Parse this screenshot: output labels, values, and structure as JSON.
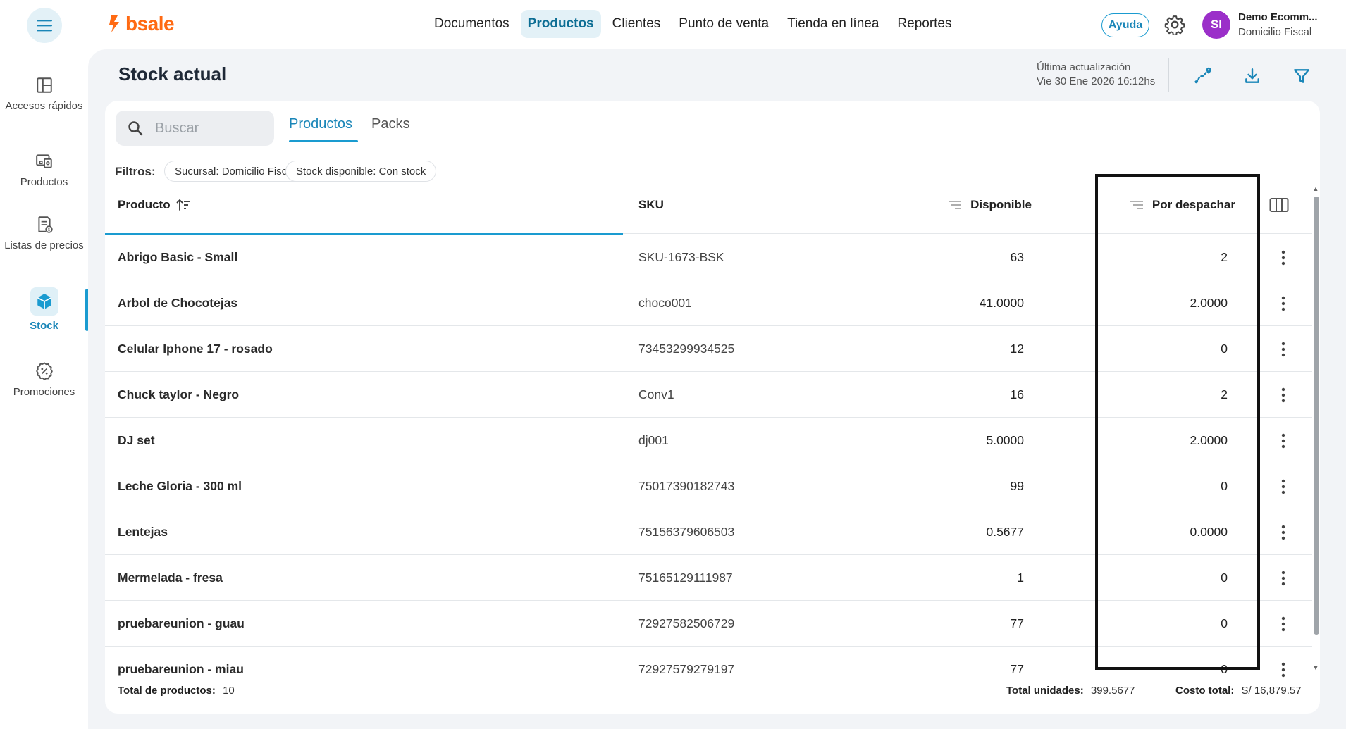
{
  "brand": {
    "logo_text": "bsale",
    "color": "#ff6a13"
  },
  "nav": {
    "items": [
      "Documentos",
      "Productos",
      "Clientes",
      "Punto de venta",
      "Tienda en línea",
      "Reportes"
    ],
    "active": "Productos"
  },
  "header": {
    "help_label": "Ayuda",
    "avatar_initials": "SI",
    "user_name": "Demo Ecomm...",
    "user_sub": "Domicilio Fiscal"
  },
  "sidebar": {
    "items": [
      {
        "label": "Accesos rápidos",
        "icon": "layout-icon"
      },
      {
        "label": "Productos",
        "icon": "products-icon"
      },
      {
        "label": "Listas de precios",
        "icon": "price-list-icon"
      },
      {
        "label": "Stock",
        "icon": "cube-icon",
        "active": true
      },
      {
        "label": "Promociones",
        "icon": "promo-icon"
      }
    ]
  },
  "page": {
    "title": "Stock actual",
    "last_update_label": "Última actualización",
    "last_update_value": "Vie 30 Ene 2026 16:12hs"
  },
  "search": {
    "placeholder": "Buscar",
    "value": ""
  },
  "tabs": [
    {
      "label": "Productos",
      "active": true
    },
    {
      "label": "Packs",
      "active": false
    }
  ],
  "filters": {
    "label": "Filtros:",
    "chips": [
      "Sucursal: Domicilio Fiscal",
      "Stock disponible: Con stock"
    ]
  },
  "table": {
    "columns": {
      "producto": "Producto",
      "sku": "SKU",
      "disponible": "Disponible",
      "por_despachar": "Por despachar"
    },
    "rows": [
      {
        "producto": "Abrigo Basic - Small",
        "sku": "SKU-1673-BSK",
        "disponible": "63",
        "por_despachar": "2"
      },
      {
        "producto": "Arbol de Chocotejas",
        "sku": "choco001",
        "disponible": "41.0000",
        "por_despachar": "2.0000"
      },
      {
        "producto": "Celular Iphone 17 - rosado",
        "sku": "73453299934525",
        "disponible": "12",
        "por_despachar": "0"
      },
      {
        "producto": "Chuck taylor - Negro",
        "sku": "Conv1",
        "disponible": "16",
        "por_despachar": "2"
      },
      {
        "producto": "DJ set",
        "sku": "dj001",
        "disponible": "5.0000",
        "por_despachar": "2.0000"
      },
      {
        "producto": "Leche Gloria - 300 ml",
        "sku": "75017390182743",
        "disponible": "99",
        "por_despachar": "0"
      },
      {
        "producto": "Lentejas",
        "sku": "75156379606503",
        "disponible": "0.5677",
        "por_despachar": "0.0000"
      },
      {
        "producto": "Mermelada - fresa",
        "sku": "75165129111987",
        "disponible": "1",
        "por_despachar": "0"
      },
      {
        "producto": "pruebareunion - guau",
        "sku": "72927582506729",
        "disponible": "77",
        "por_despachar": "0"
      },
      {
        "producto": "pruebareunion - miau",
        "sku": "72927579279197",
        "disponible": "77",
        "por_despachar": "0"
      }
    ]
  },
  "footer": {
    "total_products_label": "Total de productos:",
    "total_products_value": "10",
    "total_units_label": "Total unidades:",
    "total_units_value": "399.5677",
    "total_cost_label": "Costo total:",
    "total_cost_value": "S/ 16,879.57"
  },
  "colors": {
    "accent": "#1a9bd0",
    "avatar": "#9b2fc9",
    "highlight_border": "#111111"
  }
}
